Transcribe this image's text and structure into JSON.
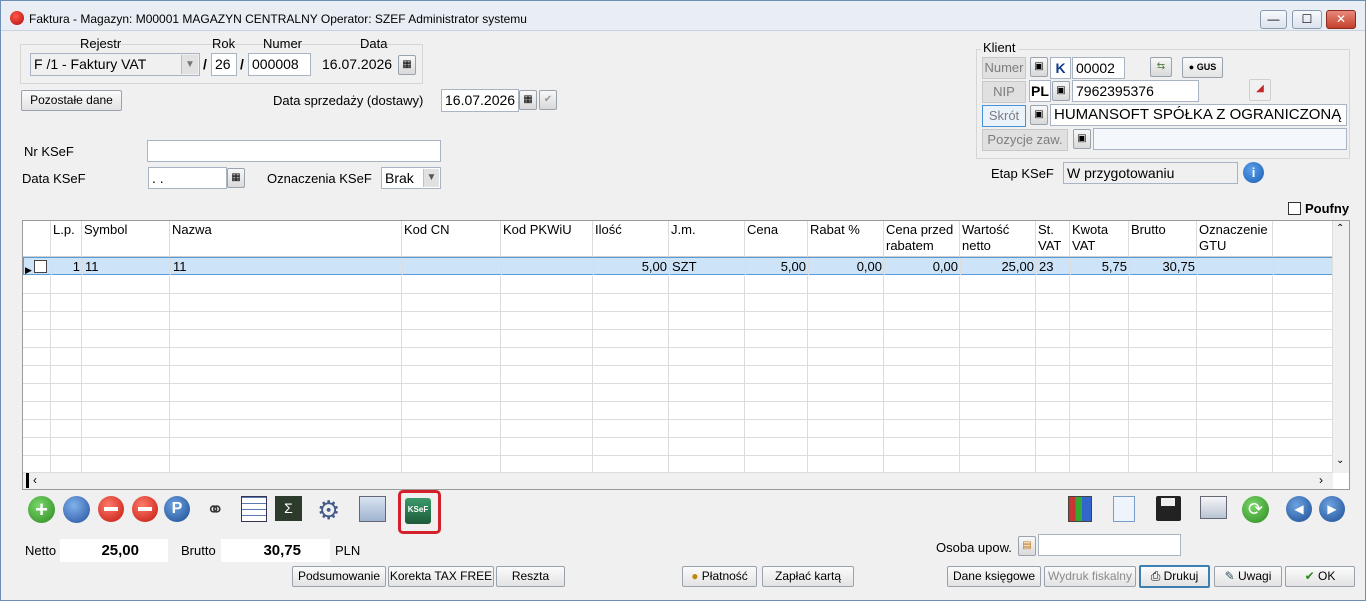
{
  "window": {
    "title": "Faktura - Magazyn: M00001 MAGAZYN CENTRALNY  Operator: SZEF Administrator systemu",
    "min_label": "—",
    "max_label": "☐",
    "close_label": "✕"
  },
  "header": {
    "rejestr_label": "Rejestr",
    "rok_label": "Rok",
    "numer_label": "Numer",
    "data_label": "Data",
    "rejestr_value": "F /1   - Faktury VAT",
    "slash": "/",
    "rok_value": "26",
    "numer_value": "000008",
    "data_value": "16.07.2026",
    "pozostale_button": "Pozostałe dane",
    "data_sprzedazy_label": "Data sprzedaży (dostawy)",
    "data_sprzedazy_value": "16.07.2026"
  },
  "ksef": {
    "nr_label": "Nr KSeF",
    "nr_value": "",
    "data_label": "Data KSeF",
    "data_value": " .  .",
    "oznaczenia_label": "Oznaczenia KSeF",
    "oznaczenia_value": "Brak",
    "etap_label": "Etap KSeF",
    "etap_value": "W przygotowaniu"
  },
  "client": {
    "section_label": "Klient",
    "numer_label": "Numer",
    "numer_prefix": "K",
    "numer_value": "00002",
    "gus_label": "GUS",
    "nip_label": "NIP",
    "nip_prefix": "PL",
    "nip_value": "7962395376",
    "skrot_label": "Skrót",
    "skrot_value": "HUMANSOFT SPÓŁKA Z OGRANICZONĄ O",
    "pozycje_label": "Pozycje zaw.",
    "pozycje_value": "",
    "poufny_label": "Poufny"
  },
  "table": {
    "columns": [
      "",
      "L.p.",
      "Symbol",
      "Nazwa",
      "Kod  CN",
      "Kod  PKWiU",
      "Ilość",
      "J.m.",
      "Cena",
      "Rabat %",
      "Cena przed rabatem",
      "Wartość netto",
      "St. VAT",
      "Kwota VAT",
      "Brutto",
      "Oznaczenie GTU"
    ],
    "rows": [
      [
        "",
        "1",
        "11",
        "11",
        "",
        "",
        "5,00",
        "SZT",
        "5,00",
        "0,00",
        "0,00",
        "25,00",
        "23",
        "5,75",
        "30,75",
        ""
      ]
    ]
  },
  "totals": {
    "netto_label": "Netto",
    "netto_value": "25,00",
    "brutto_label": "Brutto",
    "brutto_value": "30,75",
    "currency": "PLN",
    "osoba_label": "Osoba upow.",
    "osoba_value": ""
  },
  "buttons": {
    "podsumowanie": "Podsumowanie",
    "korekta": "Korekta TAX FREE",
    "reszta": "Reszta",
    "platnosc": "Płatność",
    "zaplac": "Zapłać kartą",
    "dane_ksiegowe": "Dane księgowe",
    "wydruk": "Wydruk fiskalny",
    "drukuj": "Drukuj",
    "uwagi": "Uwagi",
    "ok": "OK"
  },
  "icons": {
    "ksef_icon_text": "KSeF",
    "p_icon_text": "P",
    "sigma_icon_text": "Σ",
    "highlight_color": "#d4202a",
    "selection_color": "#cde3f8"
  }
}
